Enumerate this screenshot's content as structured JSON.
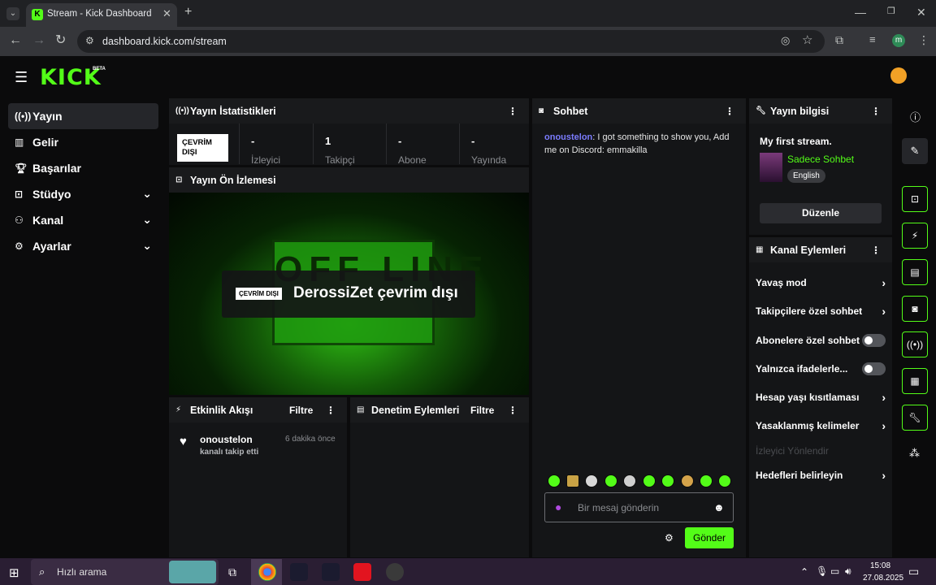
{
  "browser": {
    "tab_title": "Stream - Kick Dashboard",
    "url": "dashboard.kick.com/stream",
    "profile_initial": "m"
  },
  "header": {
    "logo": "KICK",
    "beta": "BETA"
  },
  "sidebar": {
    "items": [
      {
        "label": "Yayın",
        "icon": "broadcast-icon"
      },
      {
        "label": "Gelir",
        "icon": "chart-icon"
      },
      {
        "label": "Başarılar",
        "icon": "trophy-icon"
      },
      {
        "label": "Stüdyo",
        "icon": "studio-icon"
      },
      {
        "label": "Kanal",
        "icon": "users-icon"
      },
      {
        "label": "Ayarlar",
        "icon": "gear-icon"
      }
    ]
  },
  "stats": {
    "title": "Yayın İstatistikleri",
    "status_badge": "ÇEVRİM DIŞI",
    "items": [
      {
        "value": "-",
        "label": "İzleyici"
      },
      {
        "value": "1",
        "label": "Takipçi"
      },
      {
        "value": "-",
        "label": "Abone"
      },
      {
        "value": "-",
        "label": "Yayında"
      }
    ]
  },
  "preview": {
    "title": "Yayın Ön İzlemesi",
    "badge": "ÇEVRİM DIŞI",
    "message": "DerossiZet çevrim dışı",
    "bg_text": "OFF LINE"
  },
  "activity": {
    "title": "Etkinlik Akışı",
    "filter": "Filtre",
    "items": [
      {
        "user": "onoustelon",
        "text": "kanalı takip etti",
        "time": "6 dakika önce"
      }
    ]
  },
  "moderation": {
    "title": "Denetim Eylemleri",
    "filter": "Filtre"
  },
  "chat": {
    "title": "Sohbet",
    "messages": [
      {
        "user": "onoustelon",
        "text": ": I got something to show you, Add me on Discord: emmakilla"
      }
    ],
    "placeholder": "Bir mesaj gönderin",
    "send": "Gönder"
  },
  "stream_info": {
    "title": "Yayın bilgisi",
    "stream_title": "My first stream.",
    "category": "Sadece Sohbet",
    "language": "English",
    "edit": "Düzenle"
  },
  "channel_actions": {
    "title": "Kanal Eylemleri",
    "items": [
      {
        "label": "Yavaş mod",
        "control": "arrow"
      },
      {
        "label": "Takipçilere özel sohbet",
        "control": "arrow"
      },
      {
        "label": "Abonelere özel sohbet",
        "control": "toggle"
      },
      {
        "label": "Yalnızca ifadelerle...",
        "control": "toggle"
      },
      {
        "label": "Hesap yaşı kısıtlaması",
        "control": "arrow"
      },
      {
        "label": "Yasaklanmış kelimeler",
        "control": "arrow"
      },
      {
        "label": "İzleyici Yönlendir",
        "control": "disabled"
      },
      {
        "label": "Hedefleri belirleyin",
        "control": "arrow"
      }
    ]
  },
  "taskbar": {
    "search_placeholder": "Hızlı arama",
    "time": "15:08",
    "date": "27.08.2025"
  },
  "colors": {
    "accent": "#53fc18",
    "bg": "#0b0b0c",
    "panel": "#141517"
  }
}
